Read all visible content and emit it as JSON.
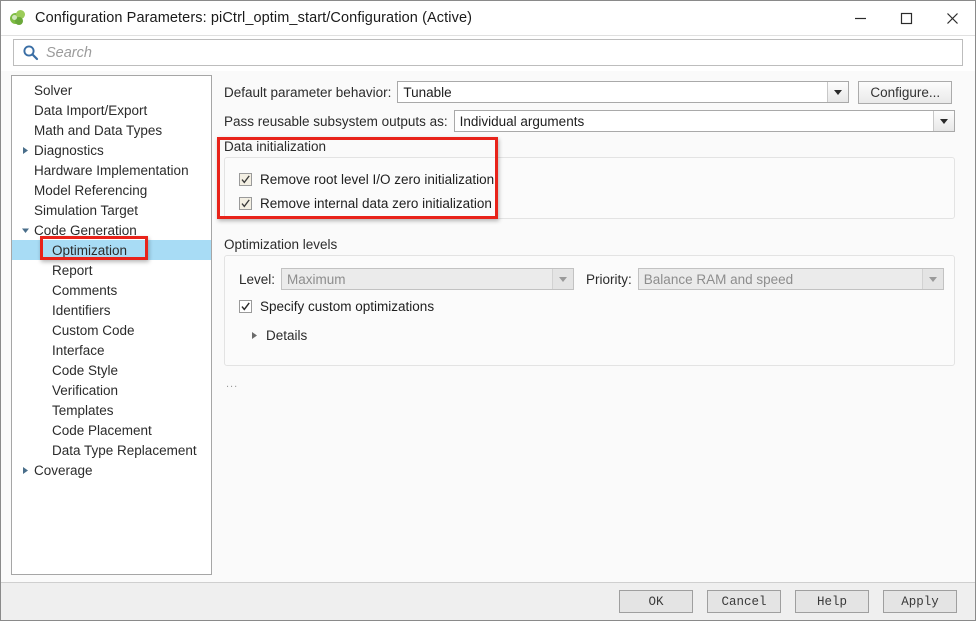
{
  "window": {
    "title": "Configuration Parameters: piCtrl_optim_start/Configuration (Active)",
    "app_icon": "simulink-icon",
    "minimize_label": "Minimize",
    "maximize_label": "Maximize",
    "close_label": "Close"
  },
  "search": {
    "placeholder": "Search",
    "value": "",
    "icon": "search-icon"
  },
  "tree": {
    "items": [
      {
        "label": "Solver",
        "indent": 1,
        "twisty": "none",
        "selected": false
      },
      {
        "label": "Data Import/Export",
        "indent": 1,
        "twisty": "none",
        "selected": false
      },
      {
        "label": "Math and Data Types",
        "indent": 1,
        "twisty": "none",
        "selected": false
      },
      {
        "label": "Diagnostics",
        "indent": 0,
        "twisty": "collapsed",
        "selected": false
      },
      {
        "label": "Hardware Implementation",
        "indent": 1,
        "twisty": "none",
        "selected": false
      },
      {
        "label": "Model Referencing",
        "indent": 1,
        "twisty": "none",
        "selected": false
      },
      {
        "label": "Simulation Target",
        "indent": 1,
        "twisty": "none",
        "selected": false
      },
      {
        "label": "Code Generation",
        "indent": 0,
        "twisty": "expanded",
        "selected": false
      },
      {
        "label": "Optimization",
        "indent": 2,
        "twisty": "none",
        "selected": true
      },
      {
        "label": "Report",
        "indent": 2,
        "twisty": "none",
        "selected": false
      },
      {
        "label": "Comments",
        "indent": 2,
        "twisty": "none",
        "selected": false
      },
      {
        "label": "Identifiers",
        "indent": 2,
        "twisty": "none",
        "selected": false
      },
      {
        "label": "Custom Code",
        "indent": 2,
        "twisty": "none",
        "selected": false
      },
      {
        "label": "Interface",
        "indent": 2,
        "twisty": "none",
        "selected": false
      },
      {
        "label": "Code Style",
        "indent": 2,
        "twisty": "none",
        "selected": false
      },
      {
        "label": "Verification",
        "indent": 2,
        "twisty": "none",
        "selected": false
      },
      {
        "label": "Templates",
        "indent": 2,
        "twisty": "none",
        "selected": false
      },
      {
        "label": "Code Placement",
        "indent": 2,
        "twisty": "none",
        "selected": false
      },
      {
        "label": "Data Type Replacement",
        "indent": 2,
        "twisty": "none",
        "selected": false
      },
      {
        "label": "Coverage",
        "indent": 0,
        "twisty": "collapsed",
        "selected": false
      }
    ]
  },
  "content": {
    "default_parameter_behavior": {
      "label": "Default parameter behavior:",
      "value": "Tunable",
      "configure_label": "Configure..."
    },
    "pass_reusable": {
      "label": "Pass reusable subsystem outputs as:",
      "value": "Individual arguments"
    },
    "data_initialization": {
      "group_label": "Data initialization",
      "checkboxes": [
        {
          "label": "Remove root level I/O zero initialization",
          "checked": true
        },
        {
          "label": "Remove internal data zero initialization",
          "checked": true
        }
      ]
    },
    "optimization_levels": {
      "group_label": "Optimization levels",
      "level_label": "Level:",
      "level_value": "Maximum",
      "level_disabled": true,
      "priority_label": "Priority:",
      "priority_value": "Balance RAM and speed",
      "priority_disabled": true,
      "specify_custom": {
        "label": "Specify custom optimizations",
        "checked": true
      },
      "details_label": "Details"
    },
    "overflow_indicator": "..."
  },
  "footer": {
    "buttons": [
      {
        "label": "OK"
      },
      {
        "label": "Cancel"
      },
      {
        "label": "Help"
      },
      {
        "label": "Apply"
      }
    ]
  },
  "annotations": {
    "accent_color": "#e8231a",
    "selection_color": "#a8dcf5"
  }
}
